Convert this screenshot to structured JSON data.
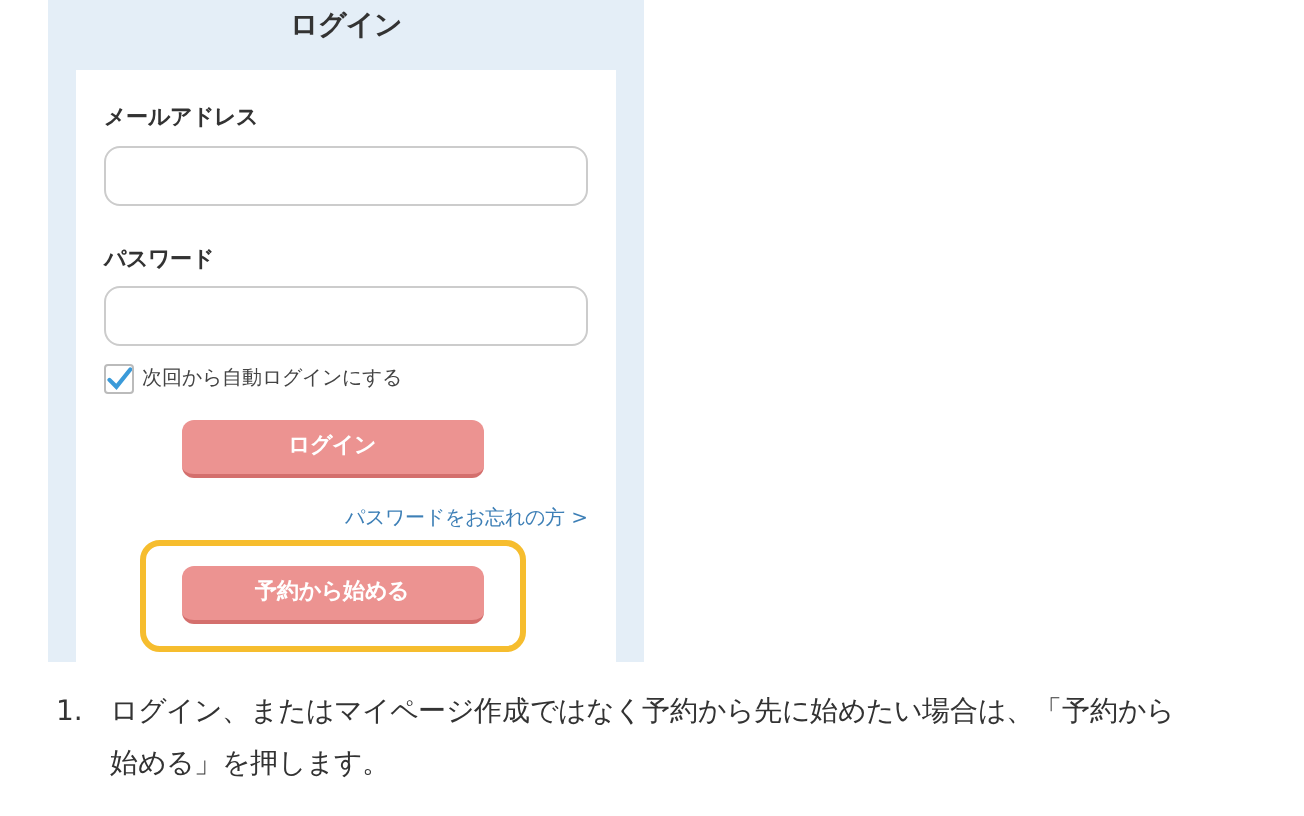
{
  "login_screenshot": {
    "title": "ログイン",
    "fields": [
      {
        "label": "メールアドレス"
      },
      {
        "label": "パスワード"
      }
    ],
    "remember": {
      "label": "次回から自動ログインにする",
      "checked": true
    },
    "login_button": "ログイン",
    "forgot_link": "パスワードをお忘れの方 >",
    "start_button": {
      "label": "予約から始める",
      "highlighted": true
    }
  },
  "instructions": [
    {
      "number": "1.",
      "text": "ログイン、またはマイページ作成ではなく予約から先に始めたい場合は、「予約から始める」を押します。"
    }
  ]
}
